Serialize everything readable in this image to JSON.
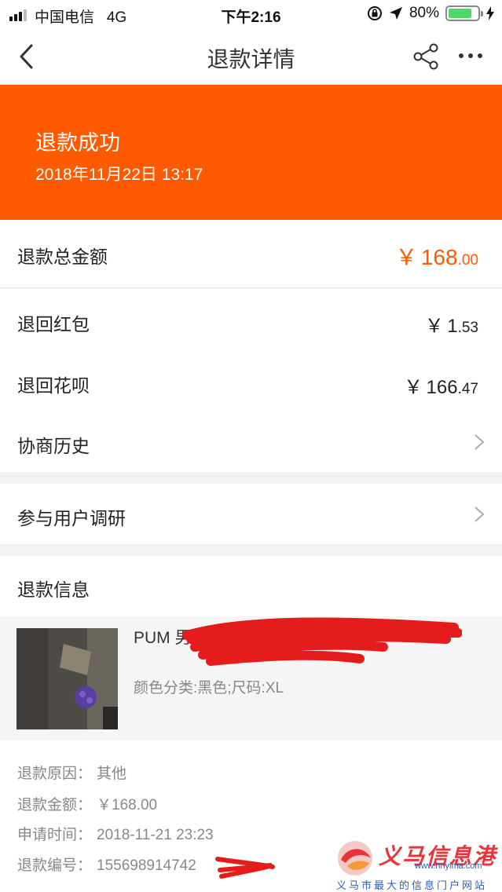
{
  "status_bar": {
    "carrier": "中国电信",
    "network": "4G",
    "time": "下午2:16",
    "battery": "80%",
    "battery_level": 0.8
  },
  "nav": {
    "title": "退款详情",
    "icons": [
      "back-icon",
      "share-icon",
      "more-icon"
    ]
  },
  "banner": {
    "status": "退款成功",
    "date": "2018年11月22日 13:17",
    "color": "#ff5a00"
  },
  "total": {
    "label": "退款总金额",
    "currency": "￥",
    "integer": "168",
    "decimal": ".00"
  },
  "breakdown": [
    {
      "label": "退回红包",
      "currency": "￥",
      "integer": "1",
      "decimal": ".53"
    },
    {
      "label": "退回花呗",
      "currency": "￥",
      "integer": "166",
      "decimal": ".47"
    }
  ],
  "history": {
    "label": "协商历史"
  },
  "survey": {
    "label": "参与用户调研"
  },
  "refund_info": {
    "heading": "退款信息",
    "product_title": "PUM 男女日",
    "product_spec": "颜色分类:黑色;尺码:XL",
    "lines": [
      {
        "key": "退款原因：",
        "value": "其他"
      },
      {
        "key": "退款金额：",
        "value": "￥168.00"
      },
      {
        "key": "申请时间：",
        "value": "2018-11-21 23:23"
      },
      {
        "key": "退款编号：",
        "value": "155698914742"
      }
    ]
  },
  "watermark": {
    "title": "义马信息港",
    "url": "www.hnyima.com",
    "subtitle": "义马市最大的信息门户网站"
  }
}
